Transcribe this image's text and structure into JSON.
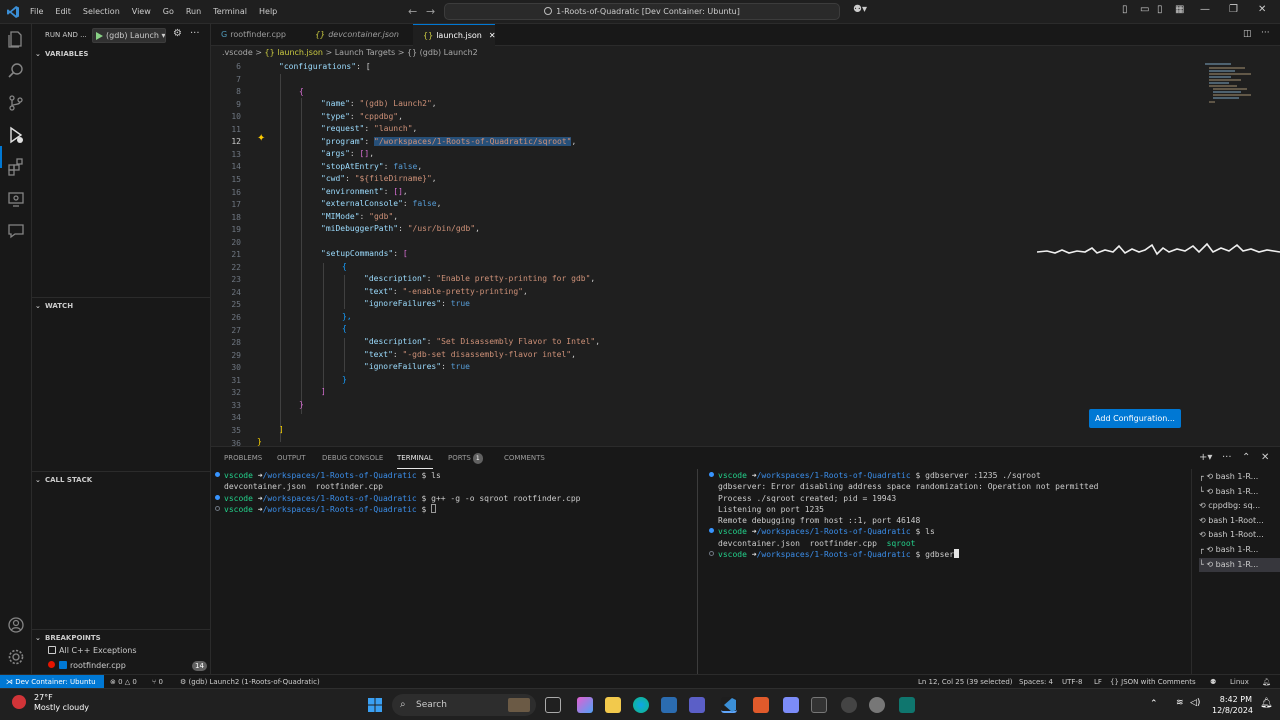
{
  "menu": [
    "File",
    "Edit",
    "Selection",
    "View",
    "Go",
    "Run",
    "Terminal",
    "Help"
  ],
  "command_center": "1-Roots-of-Quadratic [Dev Container: Ubuntu]",
  "sidebar": {
    "title": "RUN AND ...",
    "config": "(gdb) Launch",
    "variables": "VARIABLES",
    "watch": "WATCH",
    "callstack": "CALL STACK",
    "breakpoints": "BREAKPOINTS",
    "bp_items": [
      "All C++ Exceptions",
      "rootfinder.cpp"
    ],
    "bp_count": "14"
  },
  "tabs": [
    "rootfinder.cpp",
    "devcontainer.json",
    "launch.json"
  ],
  "breadcrumb": [
    ".vscode",
    ">",
    "{} launch.json",
    ">",
    "Launch Targets",
    ">",
    "{} (gdb) Launch2"
  ],
  "editor": {
    "line_numbers": [
      "6",
      "7",
      "8",
      "9",
      "10",
      "11",
      "12",
      "13",
      "14",
      "15",
      "16",
      "17",
      "18",
      "19",
      "20",
      "21",
      "22",
      "23",
      "24",
      "25",
      "26",
      "27",
      "28",
      "29",
      "30",
      "31",
      "32",
      "33",
      "34",
      "35",
      "36"
    ],
    "current_line": "12",
    "add_configuration": "Add Configuration...",
    "code": {
      "l6k": "\"configurations\"",
      "l6p": ": [",
      "l8": "{",
      "l9k": "\"name\"",
      "l9v": "\"(gdb) Launch2\"",
      "l10k": "\"type\"",
      "l10v": "\"cppdbg\"",
      "l11k": "\"request\"",
      "l11v": "\"launch\"",
      "l12k": "\"program\"",
      "l12v": "\"/workspaces/1-Roots-of-Quadratic/sqroot\"",
      "l13k": "\"args\"",
      "l13v": "[]",
      "l14k": "\"stopAtEntry\"",
      "l14v": "false",
      "l15k": "\"cwd\"",
      "l15v": "\"${fileDirname}\"",
      "l16k": "\"environment\"",
      "l16v": "[]",
      "l17k": "\"externalConsole\"",
      "l17v": "false",
      "l18k": "\"MIMode\"",
      "l18v": "\"gdb\"",
      "l19k": "\"miDebuggerPath\"",
      "l19v": "\"/usr/bin/gdb\"",
      "l21k": "\"setupCommands\"",
      "l21p": "[",
      "l22": "{",
      "l23k": "\"description\"",
      "l23v": "\"Enable pretty-printing for gdb\"",
      "l24k": "\"text\"",
      "l24v": "\"-enable-pretty-printing\"",
      "l25k": "\"ignoreFailures\"",
      "l25v": "true",
      "l26": "},",
      "l27": "{",
      "l28k": "\"description\"",
      "l28v": "\"Set Disassembly Flavor to Intel\"",
      "l29k": "\"text\"",
      "l29v": "\"-gdb-set disassembly-flavor intel\"",
      "l30k": "\"ignoreFailures\"",
      "l30v": "true",
      "l31": "}",
      "l32": "]",
      "l33": "}",
      "l35": "]",
      "l36": "}"
    }
  },
  "panel": {
    "tabs": [
      "PROBLEMS",
      "OUTPUT",
      "DEBUG CONSOLE",
      "TERMINAL",
      "PORTS",
      "COMMENTS"
    ],
    "ports_badge": "1",
    "term_left": [
      {
        "user": "vscode",
        "path": "/workspaces/1-Roots-of-Quadratic",
        "cmd": " ls"
      },
      {
        "out": "devcontainer.json  rootfinder.cpp"
      },
      {
        "user": "vscode",
        "path": "/workspaces/1-Roots-of-Quadratic",
        "cmd": " g++ -g -o sqroot rootfinder.cpp"
      },
      {
        "user": "vscode",
        "path": "/workspaces/1-Roots-of-Quadratic",
        "cmd": " "
      }
    ],
    "term_right": [
      {
        "user": "vscode",
        "path": "/workspaces/1-Roots-of-Quadratic",
        "cmd": " gdbserver :1235 ./sqroot"
      },
      {
        "out": "gdbserver: Error disabling address space randomization: Operation not permitted"
      },
      {
        "out": "Process ./sqroot created; pid = 19943"
      },
      {
        "out": "Listening on port 1235"
      },
      {
        "out": "Remote debugging from host ::1, port 46148"
      },
      {
        "user": "vscode",
        "path": "/workspaces/1-Roots-of-Quadratic",
        "cmd": " ls"
      },
      {
        "out": "devcontainer.json  rootfinder.cpp  ",
        "outg": "sqroot"
      },
      {
        "user": "vscode",
        "path": "/workspaces/1-Roots-of-Quadratic",
        "cmd": " gdbser"
      }
    ],
    "term_list": [
      "bash 1-R...",
      "bash 1-R...",
      "cppdbg: sq...",
      "bash 1-Root...",
      "bash 1-Root...",
      "bash 1-R...",
      "bash 1-R..."
    ],
    "arrow": "➜",
    "dollar": "$"
  },
  "status": {
    "remote": "Dev Container: Ubuntu",
    "errors": "0",
    "warnings": "0",
    "ports": "0",
    "debug": "(gdb) Launch2 (1-Roots-of-Quadratic)",
    "position": "Ln 12, Col 25 (39 selected)",
    "spaces": "Spaces: 4",
    "encoding": "UTF-8",
    "eol": "LF",
    "language": "JSON with Comments",
    "os": "Linux"
  },
  "taskbar": {
    "temp": "27°F",
    "weather": "Mostly cloudy",
    "search": "Search",
    "time": "8:42 PM",
    "date": "12/8/2024"
  }
}
